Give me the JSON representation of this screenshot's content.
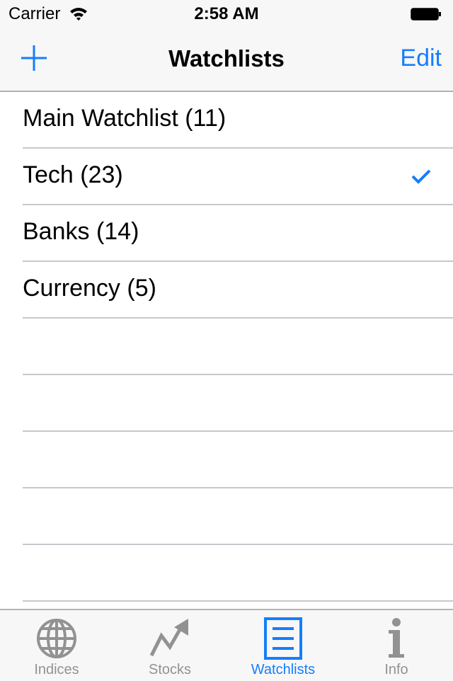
{
  "status_bar": {
    "carrier": "Carrier",
    "time": "2:58 AM"
  },
  "nav": {
    "title": "Watchlists",
    "edit_label": "Edit",
    "add_icon": "plus-icon"
  },
  "colors": {
    "accent": "#157efb",
    "inactive": "#929292"
  },
  "watchlists": [
    {
      "label": "Main Watchlist (11)",
      "selected": false
    },
    {
      "label": "Tech (23)",
      "selected": true
    },
    {
      "label": "Banks (14)",
      "selected": false
    },
    {
      "label": "Currency (5)",
      "selected": false
    }
  ],
  "empty_rows": 5,
  "tabs": [
    {
      "label": "Indices",
      "icon": "globe-icon",
      "active": false
    },
    {
      "label": "Stocks",
      "icon": "trend-arrow-icon",
      "active": false
    },
    {
      "label": "Watchlists",
      "icon": "list-icon",
      "active": true
    },
    {
      "label": "Info",
      "icon": "info-icon",
      "active": false
    }
  ]
}
